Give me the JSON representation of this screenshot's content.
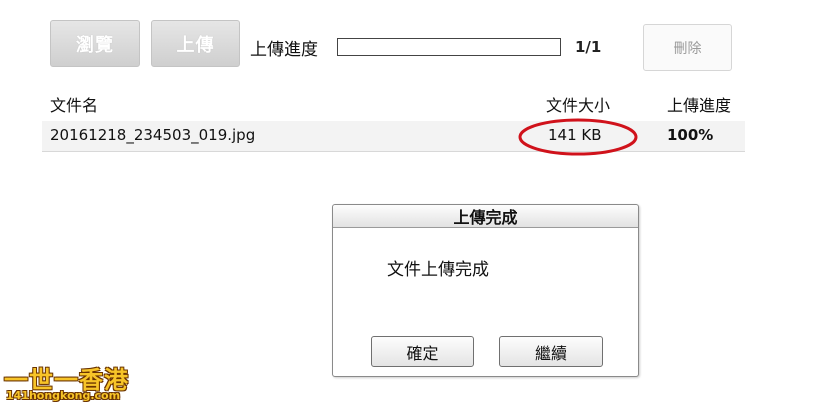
{
  "toolbar": {
    "browse_label": "瀏覽",
    "upload_label": "上傳",
    "progress_label": "上傳進度",
    "progress_fraction": 0,
    "count": "1/1",
    "delete_label": "刪除"
  },
  "table": {
    "headers": {
      "name": "文件名",
      "size": "文件大小",
      "progress": "上傳進度"
    },
    "rows": [
      {
        "name": "20161218_234503_019.jpg",
        "size": "141 KB",
        "progress": "100%"
      }
    ]
  },
  "dialog": {
    "title": "上傳完成",
    "message": "文件上傳完成",
    "ok_label": "確定",
    "continue_label": "繼續"
  },
  "watermark": {
    "title": "一世一香港",
    "site": "141hongkong.com"
  },
  "colors": {
    "highlight_circle": "#d0121b",
    "button_disabled": "#d4d4d4"
  }
}
